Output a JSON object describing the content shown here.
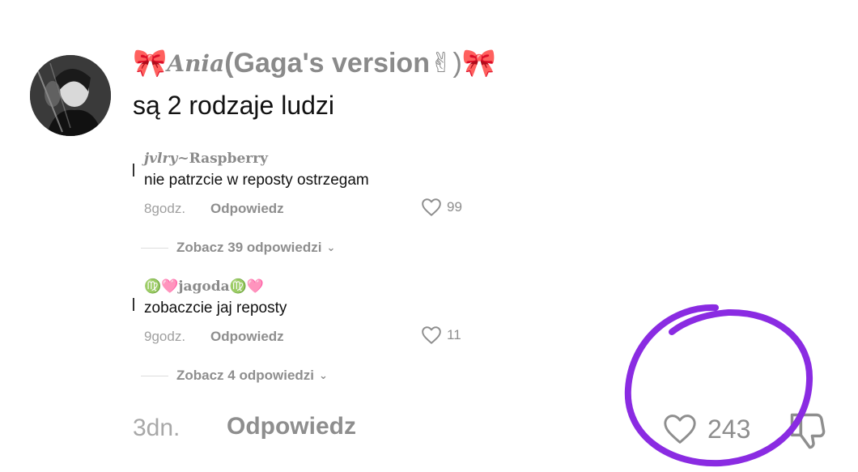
{
  "comment": {
    "username_prefix": "🎀",
    "username_script": "Ania",
    "username_rest": "(Gaga's version",
    "username_emoji": "✌",
    "username_suffix": ")🎀",
    "text": "są 2 rodzaje ludzi",
    "time": "3dn.",
    "reply_label": "Odpowiedz",
    "likes": "243"
  },
  "replies": [
    {
      "name_italic": "jvlry",
      "name_rest": "~Raspberry",
      "text": "nie patrzcie w reposty ostrzegam",
      "time": "8godz.",
      "reply_label": "Odpowiedz",
      "likes": "99",
      "see_more": "Zobacz 39 odpowiedzi"
    },
    {
      "name_italic": "",
      "name_rest": "♍🩷jagoda♍🩷",
      "text": "zobaczcie jaj reposty",
      "time": "9godz.",
      "reply_label": "Odpowiedz",
      "likes": "11",
      "see_more": "Zobacz 4 odpowiedzi"
    }
  ],
  "colors": {
    "annotation_circle": "#8a2be2",
    "muted_text": "#8e8e8e"
  },
  "icons": {
    "like": "heart-outline-icon",
    "dislike": "thumbs-down-icon",
    "see_more": "chevron-down-icon"
  }
}
